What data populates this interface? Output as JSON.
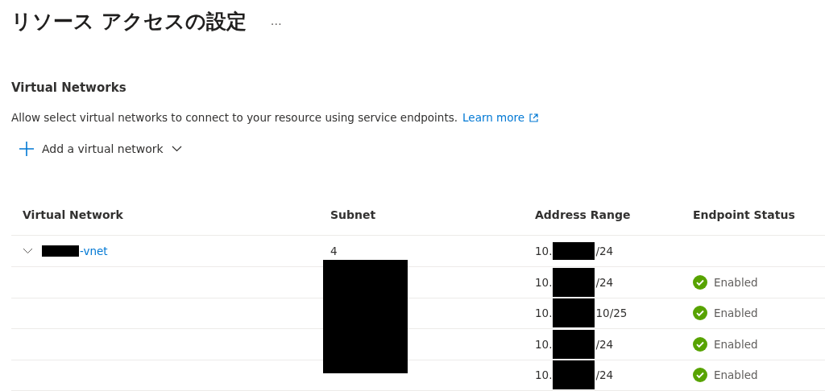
{
  "page": {
    "title": "リソース アクセスの設定",
    "more": "…"
  },
  "section": {
    "heading": "Virtual Networks",
    "description": "Allow select virtual networks to connect to your resource using service endpoints.",
    "link": "Learn more",
    "add_button": "Add a virtual network"
  },
  "table": {
    "columns": [
      "Virtual Network",
      "Subnet",
      "Address Range",
      "Endpoint Status"
    ],
    "rows": [
      {
        "kind": "network",
        "expanded": true,
        "name": "-vnet",
        "subnet": "4",
        "address_prefix": "10.",
        "address_suffix": "/24"
      },
      {
        "kind": "subnet",
        "address_prefix": "10.",
        "address_suffix": "/24",
        "status": "Enabled"
      },
      {
        "kind": "subnet",
        "address_prefix": "10.",
        "address_suffix": "10/25",
        "status": "Enabled"
      },
      {
        "kind": "subnet",
        "address_prefix": "10.",
        "address_suffix": "/24",
        "status": "Enabled"
      },
      {
        "kind": "subnet",
        "address_prefix": "10.",
        "address_suffix": "/24",
        "status": "Enabled"
      }
    ]
  }
}
